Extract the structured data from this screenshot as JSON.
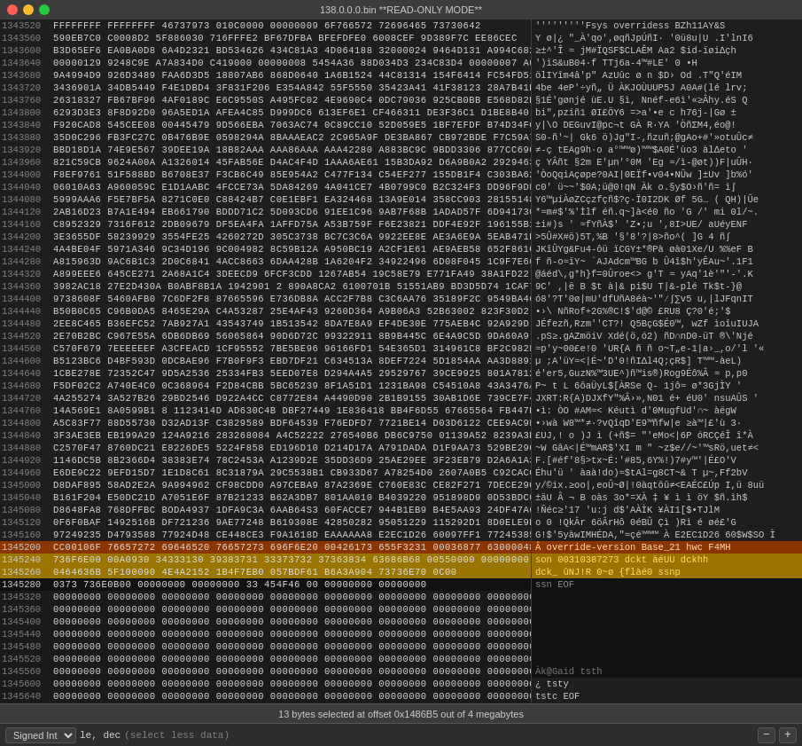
{
  "titlebar": {
    "title": "138.0.0.0.bin **READ-ONLY MODE**"
  },
  "statusbar": {
    "text": "13 bytes selected at offset 0x1486B5 out of 4 megabytes"
  },
  "toolbar": {
    "type_label": "Signed Int",
    "format_label": "le, dec",
    "hint": "(select less data)",
    "minus_label": "−",
    "plus_label": "+"
  },
  "hex_rows": [
    {
      "addr": "1343520",
      "hex": "FFFFFFFF FFFFFFFF 46737973 010C0000 00000009 6F766572 72696465 73730642",
      "text": "'''''''''Fsys     overridess BZh11AY&S"
    },
    {
      "addr": "1343560",
      "hex": "590EB7C0 C0008D2 5F886030 716FFFE2 BF67DFBA BFEFDFE0 6008CEF 9D389F7C EE86CEC",
      "text": "Y ø|¿ \"_À'qo',øqñJpÚñI· '0ü8u|U .I'lnI6"
    },
    {
      "addr": "1343600",
      "hex": "B3D65EF6 EA0BA0D8 6A4D2321 BD534626 434C81A3 4D064188 32000024 9464D131 A994C682 68000000",
      "text": "≥±^'Î ≈ jM#ÏQSF$CLAÊM Aa2 $id-ïøi∆çh"
    },
    {
      "addr": "1343640",
      "hex": "00000129 9248C9E A7A834D0 C419000 00000008 5454A36 88D034D3 234C83D4 00000007 A0B0A548",
      "text": "')ïS&uB04·f   TTj6a-4™#LE'   0 •H"
    },
    {
      "addr": "1343680",
      "hex": "9A4994D9 926D3489 FAA6D3D5 18807AB6 868D0640 1A6B1524 44C81314 154F6414 FC54FD51 FAA3F54D",
      "text": "ölIYîm4â'p\"  AzUûc ø n $D›  Od  .T\"Q'éIM"
    },
    {
      "addr": "1343720",
      "hex": "3436901A 34DB5449 F4E1DBD4 3F831F206 E354A842 55F5550 35423A41 41F38123 28A7B41D 6C72763B",
      "text": "4be 4eP'÷yñ„ Ü ÀKJOÙUUP5J  A0A#(lé lrv;"
    },
    {
      "addr": "1343760",
      "hex": "26318327 FB67BF96 4AF0189C E6C9550S A495FC02 4E9690C4 0DC79036 925CB0BB E568D82E 8E351551",
      "text": "§1É'gønjé ùE.U §ì, Nnéf-e6ì'«≥Âhy.éS Q"
    },
    {
      "addr": "1343800",
      "hex": "6293D3E3 8F8D92D0 96A5ED1A AFEA4C85 D999DC6 613EF6E1 CF466311 DE3F36C1 D1BE8B40 0CB3881B",
      "text": "bi\",pziñ1 ØI£ÖY6 =>a'•e c h76j-|Gø ±"
    },
    {
      "addr": "1343840",
      "hex": "F920CAD8 545CEE08 00445479 9D566EBA 7063AC74 0C89CC10 52D059E5 1BF7EFDF B74D34FC A398A921",
      "text": "  y|\\O DEGuvI@pc¬t GÀ R·YA 'ÒñΣM4,éo@!"
    },
    {
      "addr": "1343880",
      "hex": "35D0C296 FB3FC27C 0B476B9E 0598294A 8BAAAEAC2 2C965A9F DE3BA867 CB972BDE F7C59A74 9DCD8DAD",
      "text": "S0-ñ'~| Gk6 ö)Jg\"I-,ñzuñ;@gAo+#'»otuÛc≠"
    },
    {
      "addr": "1343920",
      "hex": "BBD18D1A 74E9E567 39DEE19A 18B82AAA AAA86AAA AAA42280 A883BC9C 9BDD3306 877CC690 74981CD5",
      "text": "≠-ç tEAg9h·o a°™™ø)™™$A0É'ùo3 àl∆eto '"
    },
    {
      "addr": "1343960",
      "hex": "821C59CB 9624A00A A1326014 45FAB56E D4AC4F4D 1AAA6AE61 15B3DA92 D6A9B0A2 29294631 75B748C2",
      "text": "ç YÂñt §2m E'µn'°0M 'Eg ≈/ì-@øt))F|uÛH·"
    },
    {
      "addr": "1344000",
      "hex": "F8EF9761 51F588BD B6708E37 F3CB6C49 85E954A2 C477F134 C54EF277 155DB1F4 C303BA62 25289722",
      "text": "'ÒoQqiAçøpe?0AI|0EÏf•v04•NÛw ]±Uv ]b%ó'"
    },
    {
      "addr": "1344040",
      "hex": "06010A63 A960059C E1D1AABC 4FCCE73A 5DA84269 4A041CE7 4B0799C0 B2C324F3 DD96F9DF B00C15C",
      "text": "  c0' ü~~'$0A;ü@0!qN Àk o.§y$O›ñ'ñ= ì∫"
    },
    {
      "addr": "1344080",
      "hex": "5999AAA6 F5E7BF5A 8271C0E0 C88424B7 C0E1EBF1 EA324468 13A9E014 358CC903 28155148 2921F3BE",
      "text": "Y6™µiÀøZCçzfçñ$?ç·Ï0I2DK Øf 5G… ( QH)|Ûe"
    },
    {
      "addr": "1344120",
      "hex": "2AB16D23 B7A1E494 EB661790 BDDD71C2 5D093CD6 91EE1C96 9AB7F68B 1ADAD57F 6D941730 6CDAC22E",
      "text": "*≈m#$'%'İlf éñ.q~]à<é0 ño 'G /' mi 0l/~."
    },
    {
      "addr": "1344160",
      "hex": "C8952329 7316F612 2DB09679 DF5EA4FA 1AFFD75A A53B759F F6E23821 DDF4E92F 196155B1 79454E46",
      "text": "±i#)s ' ≈fYñÀ$' 'Z•;u ',8I>UE/ aUéyENF"
    },
    {
      "addr": "1344200",
      "hex": "3E3655DF 58239929 3554FE25 4260272D 305C3738 BC7C3C6A 9922EE8E AE3A6E9A 5EAB471E C31D2AAB",
      "text": ">5Û#X#ö)5T,%B '§'8'?|8>ño^( ]G 4 ñ∫"
    },
    {
      "addr": "1344240",
      "hex": "4A4BE04F 5971A346 9C34D196 9C004982 8C59B12A A950BC19 A2CF1E61 AE9AEB58 652F861C 252ADB46",
      "text": "JKîÛYg&Fu4-ôü ïCGY±*®Pà øà01Xe/U %%eF B"
    },
    {
      "addr": "1344280",
      "hex": "A815963D 9AC6B1C3 2D0C6841 4ACC8663 6DAA428B 1A6204F2 34922496 6D08F045 1C9F7E60 A7EF54631",
      "text": "f ñ-o≈ïY~ `AJAdcm™BG b Û4î$h'yÊAu~'.1F1"
    },
    {
      "addr": "1344320",
      "hex": "A899EEE6 645CE271 2A68A1C4 3DEECD9 6FCF3CDD 1267AB54 19C58E79 E771FA49 38A1FD22 C2F6E14B",
      "text": "@áéd\\,g*h}f=0Ûroe<> g'T ≈ yAq'1è'\"'-'.K"
    },
    {
      "addr": "1344360",
      "hex": "3982AC18 27E2D430A B0ABF8B1A 1942901 2 890A8CA2 6100701B 51551AB9 BD3D5D74 1CAF7D8E",
      "text": "9C'  ,|ë B $t à|& pi$U T|&-plé Tk$t-}@"
    },
    {
      "addr": "1344400",
      "hex": "9738608F 5460AFB0 7C6DF2F8 87665596 E736DB8A ACC2F7B8 C3C6AA76 35189F2C 9549BA46 7164954",
      "text": "ó8'?T'0ø|mU'dfUñA8éà~'\"⁄∫∑v5 u,|lJFqnIT"
    },
    {
      "addr": "1344440",
      "hex": "B50B0C65 C96B0DA5 8465E29A C4A53287 25E4AF43 9260D364 A9B06A3 52B63002 823F30D2 BE3B22B2",
      "text": "•›\\ NñRof+2G%®C!$'d@© £RU8 Ç?0'é;'$"
    },
    {
      "addr": "1344480",
      "hex": "2EE8C465 B36EFC52 7AB927A1 43543749 1B513542 8DA7E8A9 EF4DE30E 775AEB4C 92A929D 6EA9D4AE5",
      "text": "JÉfezñ,Rzm''CT?! Q5BçG$É0™, wZf ìoîuIUJA"
    },
    {
      "addr": "1344520",
      "hex": "2E70B2BC C967E55A 6DB6DB69 56065864 90D6D72C 99322911 8B9B445C 6E4A9C5D 9DA60A9 264EC190",
      "text": ".pS≥.gAZmöiV Xdé(ö,ó2)  ñD∩nD0-üT ®\\'Njé"
    },
    {
      "addr": "1344560",
      "hex": "C570F679 7EEEEEEF A3CFEACD 1CF95552 7BE5BE96 96166FD1 54E365D1 314961C8 BF2C982F 7C1EAB7",
      "text": "≈p'y~00£e!0 'UR{A ñ ñ o~T„e-1|a›_,o/'l '«"
    },
    {
      "addr": "1344600",
      "hex": "B5123BC6 D4BF593D 0DCBAE96 F7B0F9F3 EBD7DF21 C634513A 8DEF7224 5D1854AA AA3D8891 4C29E216",
      "text": "µ ;A'üY≈<|É~'D'0!ñI∆l4Q;çR$] T™™-àeL)"
    },
    {
      "addr": "1344640",
      "hex": "1CBE278E 72352C47 9D5A2536 25334FB3 5EED07E8 D294A4A5 29529767 39CE9925 801A7812 782C7B30",
      "text": "é'er5,GuzN%™3UE^)ñ™is®)Rog9Éô%Â ≈ p,p0"
    },
    {
      "addr": "1344680",
      "hex": "F5DF02C2 A740E4C0 0C368964 F2D84CBB 5BC65239 8F1A51D1 1231BA98 C54510A8 43A3476A 99BC7AB8",
      "text": "P~ t L 6ôaÜyL$[ÀRSe Q- 1jô≈ ø*3GjÌY '"
    },
    {
      "addr": "1344720",
      "hex": "4A255274 3A527B26 29BD2546 D922A4CC C8772E84 A4490D90 2B1B9155 30AB1D6E 739CE7F4 4F02A120",
      "text": "JXRT:R{A)DJXfY\"%Â›»,N01 é+ éU0' nsuAÛS '"
    },
    {
      "addr": "1344760",
      "hex": "14A569E1 8A0599B1 8 1123414D AD630C4B DBF27449 1E836418 BB4F6D55 67665564 FB447E13 898F6757",
      "text": "•ì: ÒO #AM≈<  Kéutì d'0MugfUd'∩~  àëgW"
    },
    {
      "addr": "1344800",
      "hex": "A5C83F77 88D55730 D32AD13F C3829589 BDF64539 F76EDFD7 7721BE14 D03D6122 CEE9AC9F 151F33D0",
      "text": "•›wà W8™*≠·?vQîqD'E9™ñfw|e ≥à™|£'ù 3·"
    },
    {
      "addr": "1344840",
      "hex": "3F3AE3EB EB199A29 124A9216 283268084 A4C52222 276540B6 DB6C9750 01139A52 8239A3EC 0AE82A08",
      "text": "£UJ,! o )J ì (+ñ$= \"'eMo<|6P  óRCÇéÎ î*À"
    },
    {
      "addr": "1344880",
      "hex": "C2570F47 8760DC21 E8226DE5 5224F858 ED196D10 D214D17A A791DADA D1F9AA73 529BE29C CF74D73C",
      "text": "~W GâA<|É™mAR$'XI m \" ~z$e//~'™sRö,uet≠<"
    },
    {
      "addr": "1344920",
      "hex": "1146DC5B 8B2366D4 38383E74 78C2453A A1239D2E 35DD36D9 25AE29EE 3F23EB79 D2A6A1A3 F4B6D556",
      "text": "F.[#éf'8§>tx~É:'#85,6Y%!)7#y™'|É£O'V"
    },
    {
      "addr": "1344960",
      "hex": "E6DE9C22 9EFD15D7 1E1D8C61 8C31879A 29C5538B1 CB933D67 A78254D0 2607A0B5 C92CACC4 326256618",
      "text": "Éhu'ü ' àaà!do)≈$tAl=g8CT~& T µ~,Ff2bV"
    },
    {
      "addr": "1345000",
      "hex": "D8DAF895 58AD2E2A 9A994962 CF98CDD0 A97CEBA9 87A2369E C760E83C CE82F271 7DECE29C 0GA79E9F",
      "text": "y/©ix.≥oo|,eoÛ~Ø|!0àqtôû≠<EAÉC£Úp I,ü 8uü"
    },
    {
      "addr": "1345040",
      "hex": "B161F204 E50DC21D A7051E6F 87B21233 B62A3DB7 801AA010 B4039220 951898D9 0D53BDC0 9268A2F7",
      "text": "±äU Â ¬ B oàs 3o*=XÀ ‡ ¥ ì ì öY $ñ.ìh$"
    },
    {
      "addr": "1345080",
      "hex": "D8648FA8 768DFFBC BODA4937 1DFA9C3A 6AAB64S3 60FACCE7 944B1EB9 B4E5AA93 24DF47A6 6544A24D",
      "text": "!Ñéc≥'17 'u:j d$'AÀÌK  ¥ÀI1[$•TJlM"
    },
    {
      "addr": "1345120",
      "hex": "0F6F0BAF 1492516B DF721236 9AE77248 B619308E 42850282 95051229 115292D1 8D0ELE9E E6221847",
      "text": "o 0 !QkÂr 6öÂrHô 0éBÛ Çì )Rì é øé£'G"
    },
    {
      "addr": "1345160",
      "hex": "97249235 D4793588 77924D48 CE448CE3 F9A1618D EAAAAAA8 E2EC1D26 60097FF1 77245385 09B0EBF7",
      "text": "G!$'5yàwIMHÉDA,\"≈çé™™™ À E2EC1D26 60$W$SO  Ì"
    },
    {
      "addr": "1345200",
      "hex": "CC00106F 76657272 69646520 76657273 696F6E20 00426173 655F3231 00036877 63000048 63344D483",
      "text": "Â  override-version Base_21  hwc F4MH"
    },
    {
      "addr": "1345240",
      "hex": "736F6E00 00A0930 34333130 39383731 33373732 37363834 63686B68 00550000 00000000 00000000",
      "text": "son   00310387273 dckt  àéUU dckhh"
    },
    {
      "addr": "1345260",
      "hex": "0464636B 5F100090 4E4A2152 1B4F7EB0 057BDF61 B6A3A904 73736E70 0C00",
      "text": "dck_  ûNJ!R 0~ø {flàé0  ssnp"
    },
    {
      "addr": "1345280",
      "hex": "0373 736E0B00 00000000 00000000 33 454F46 00 00000000 00000000",
      "text": " ssn          EOF"
    },
    {
      "addr": "1345320",
      "hex": "00000000 00000000 00000000 00000000 00000000 00000000 00000000 00000000 00000000 00000000",
      "text": ""
    },
    {
      "addr": "1345360",
      "hex": "00000000 00000000 00000000 00000000 00000000 00000000 00000000 00000000 00000000 00000000",
      "text": ""
    },
    {
      "addr": "1345400",
      "hex": "00000000 00000000 00000000 00000000 00000000 00000000 00000000 00000000 00000000 00000000",
      "text": ""
    },
    {
      "addr": "1345440",
      "hex": "00000000 00000000 00000000 00000000 00000000 00000000 00000000 00000000 00000000 00000000",
      "text": ""
    },
    {
      "addr": "1345480",
      "hex": "00000000 00000000 00000000 00000000 00000000 00000000 00000000 00000000 00000000 00000000",
      "text": ""
    },
    {
      "addr": "1345520",
      "hex": "00000000 00000000 00000000 00000000 00000000 00000000 00000000 00000000 00000000 00000000",
      "text": ""
    },
    {
      "addr": "1345560",
      "hex": "00000000 00000000 00000000 00000000 00000000 00000000 00000000 00000000 00000000 00000000",
      "text": "                  Àk@Gaid     tsth"
    },
    {
      "addr": "1345600",
      "hex": "00000000 00000000 00000000 00000000 00000000 00000000 00000000 00000000 00000000 00000000",
      "text": "¿ tsty"
    },
    {
      "addr": "1345640",
      "hex": "00000000 00000000 00000000 00000000 00000000 00000000 00000000 00000000 00000000 00000000",
      "text": "  tstc     EOF"
    }
  ],
  "highlighted_rows": {
    "row_1345200": "orange",
    "row_1345240": "yellow",
    "row_1345260": "yellow_dark",
    "row_1345280": "black"
  }
}
